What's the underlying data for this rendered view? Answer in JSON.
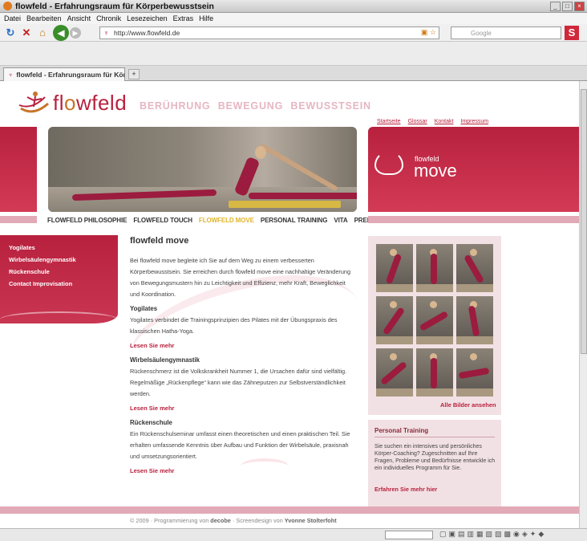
{
  "browser": {
    "window_title": "flowfeld - Erfahrungsraum für Körperbewusstsein",
    "menu": [
      "Datei",
      "Bearbeiten",
      "Ansicht",
      "Chronik",
      "Lesezeichen",
      "Extras",
      "Hilfe"
    ],
    "url": "http://www.flowfeld.de",
    "search_placeholder": "Google",
    "tab_title": "flowfeld - Erfahrungsraum für Körp ...",
    "new_tab": "+"
  },
  "site": {
    "logo": "flowfeld",
    "tagline": "BERÜHRUNG  BEWEGUNG  BEWUSSTSEIN",
    "toplinks": [
      "Startseite",
      "Glossar",
      "Kontakt",
      "Impressum"
    ],
    "nav": [
      "FLOWFELD PHILOSOPHIE",
      "FLOWFELD TOUCH",
      "FLOWFELD MOVE",
      "PERSONAL TRAINING",
      "VITA",
      "PREISE"
    ],
    "nav_active": "FLOWFELD MOVE",
    "move_small": "flowfeld",
    "move_big": "move",
    "sidebar": [
      "Yogilates",
      "Wirbelsäulengymnastik",
      "Rückenschule",
      "Contact Improvisation"
    ],
    "content": {
      "title": "flowfeld move",
      "intro": "Bei flowfeld move begleite ich Sie auf dem Weg zu einem verbesserten Körperbewusstsein. Sie erreichen durch flowfeld move eine nachhaltige Veränderung von Bewegungsmustern hin zu Leichtigkeit und Effizienz, mehr Kraft, Beweglichkeit und Koordination.",
      "sections": [
        {
          "heading": "Yogilates",
          "text": "Yogilates verbindet die Trainingsprinzipien des Pilates mit der Übungspraxis des klassischen Hatha-Yoga.",
          "more": "Lesen Sie mehr"
        },
        {
          "heading": "Wirbelsäulengymnastik",
          "text": "Rückenschmerz ist die Volkskrankheit Nummer 1, die Ursachen dafür sind vielfältig. Regelmäßige „Rückenpflege“ kann wie das Zähneputzen zur Selbstverständlichkeit werden.",
          "more": "Lesen Sie mehr"
        },
        {
          "heading": "Rückenschule",
          "text": "Ein Rückenschulseminar umfasst einen theoretischen und einen praktischen Teil. Sie erhalten umfassende Kenntnis über Aufbau und Funktion der Wirbelsäule, praxisnah und umsetzungsorientiert.",
          "more": "Lesen Sie mehr"
        }
      ]
    },
    "gallery_link": "Alle Bilder ansehen",
    "personal_training": {
      "title": "Personal Training",
      "text": "Sie suchen ein intensives und persönliches Körper-Coaching? Zugeschnitten auf Ihre Fragen, Probleme und Bedürfnisse entwickle ich ein individuelles Programm für Sie.",
      "link": "Erfahren Sie mehr hier"
    },
    "footer": {
      "year": "© 2009",
      "prog_label": "· Programmierung von",
      "prog_name": "decobe",
      "design_label": "· Screendesign von",
      "design_name": "Yvonne Stolterfoht"
    }
  },
  "colors": {
    "brand_red": "#b8213e",
    "accent_gold": "#e0b52a",
    "light_pink": "#e2a9b6"
  }
}
